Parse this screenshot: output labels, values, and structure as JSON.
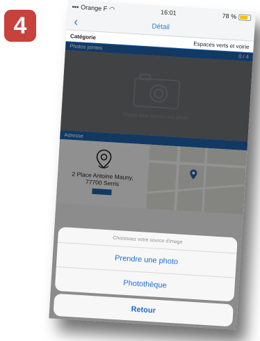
{
  "step": {
    "number": "4"
  },
  "status_bar": {
    "carrier": "Orange F",
    "time": "16:01",
    "battery": "78 %"
  },
  "nav": {
    "title": "Détail",
    "back_icon": "chevron-left-icon"
  },
  "category": {
    "label": "Catégorie",
    "value": "Espaces verts et voirie"
  },
  "photos": {
    "header": "Photos jointes",
    "count": "0 / 4",
    "hint": "Cliquer pour ajouter une photo",
    "icon": "camera-icon"
  },
  "address": {
    "header": "Adresse",
    "line1": "2 Place Antoine Mauny,",
    "line2": "77700 Serris",
    "icon": "map-pin-icon"
  },
  "action_sheet": {
    "title": "Choisissez votre source d'image",
    "options": [
      "Prendre une photo",
      "Photothèque"
    ],
    "cancel": "Retour"
  },
  "colors": {
    "accent": "#1d5fa6",
    "ios_blue": "#1c6ed1",
    "badge": "#c8413a"
  }
}
